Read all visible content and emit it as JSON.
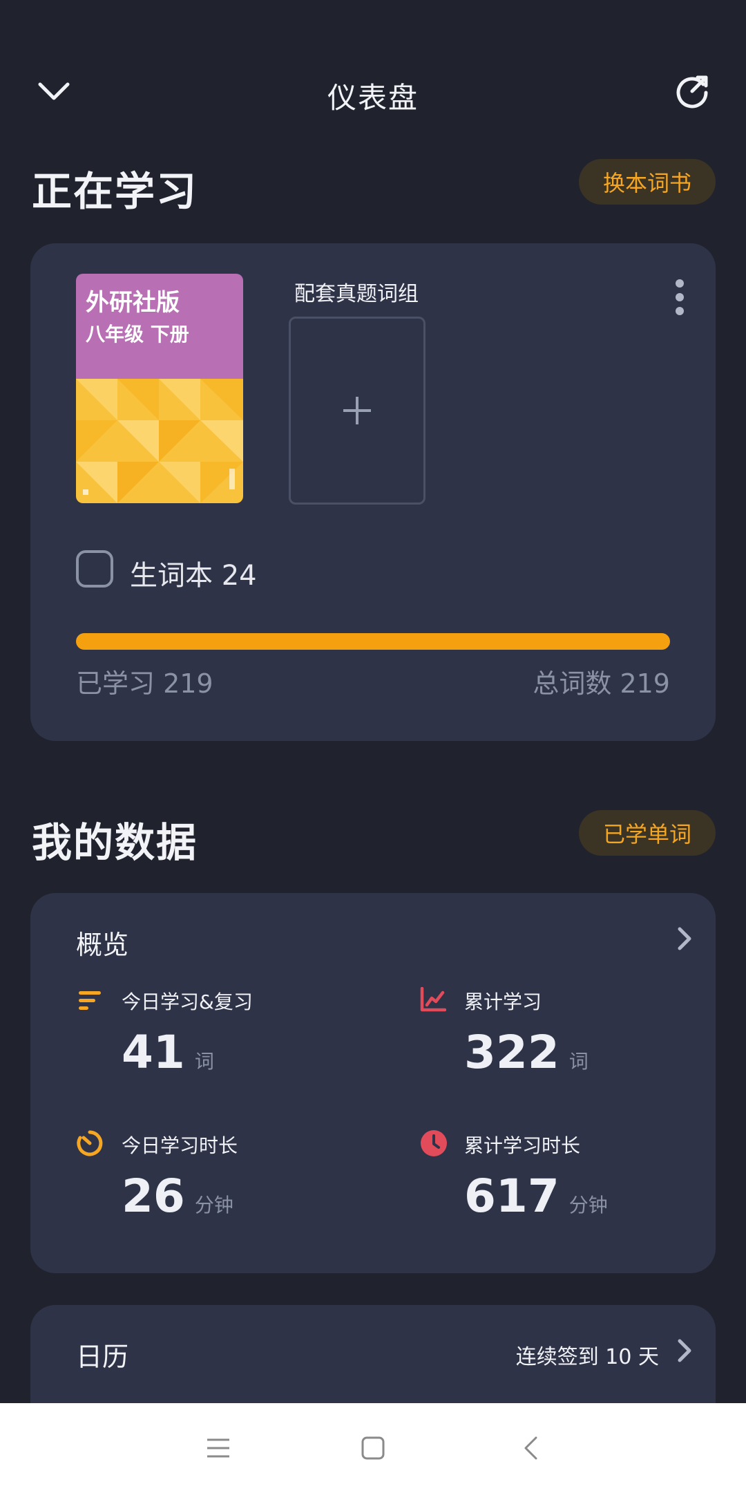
{
  "header": {
    "title": "仪表盘",
    "left_icon": "chevron-down-icon",
    "right_icon": "refresh-arrow-icon"
  },
  "studying": {
    "title": "正在学习",
    "change_book_label": "换本词书",
    "book": {
      "publisher": "外研社版",
      "grade": "八年级  下册"
    },
    "group_title": "配套真题词组",
    "vocab_label": "生词本 24",
    "learned_label": "已学习 219",
    "total_label": "总词数 219",
    "progress": 1.0
  },
  "my_data": {
    "title": "我的数据",
    "learned_words_label": "已学单词",
    "overview": {
      "title": "概览",
      "stats": [
        {
          "label": "今日学习&复习",
          "value": "41",
          "unit": "词",
          "icon": "bars-icon",
          "color": "#f5a623"
        },
        {
          "label": "累计学习",
          "value": "322",
          "unit": "词",
          "icon": "line-chart-icon",
          "color": "#e14b5a"
        },
        {
          "label": "今日学习时长",
          "value": "26",
          "unit": "分钟",
          "icon": "timer-icon",
          "color": "#f5a623"
        },
        {
          "label": "累计学习时长",
          "value": "617",
          "unit": "分钟",
          "icon": "clock-icon",
          "color": "#e14b5a"
        }
      ]
    }
  },
  "calendar": {
    "title": "日历",
    "streak_label": "连续签到 10 天"
  },
  "colors": {
    "background": "#20232e",
    "card": "#2e3347",
    "accent": "#f5a623",
    "accent_red": "#e14b5a"
  }
}
